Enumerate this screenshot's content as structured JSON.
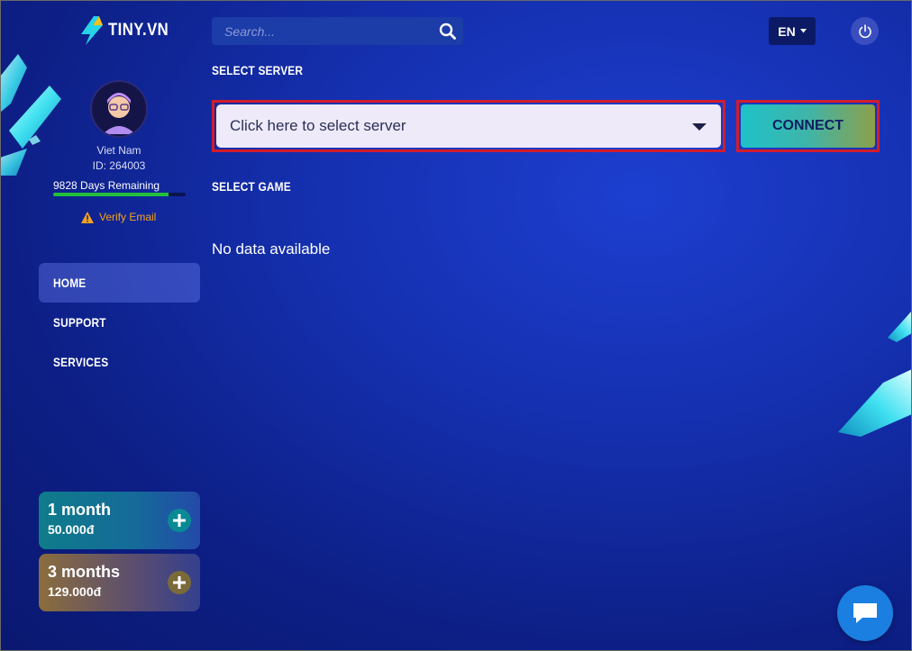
{
  "app": {
    "logo_text": "TINY.VN"
  },
  "user": {
    "country": "Viet Nam",
    "id": "ID: 264003",
    "days_remaining": "9828 Days Remaining",
    "days_progress": 0.87,
    "verify_email": "Verify Email"
  },
  "nav": {
    "items": [
      {
        "label": "HOME"
      },
      {
        "label": "SUPPORT"
      },
      {
        "label": "SERVICES"
      }
    ]
  },
  "plans": [
    {
      "name": "1 month",
      "price": "50.000đ"
    },
    {
      "name": "3 months",
      "price": "129.000đ"
    }
  ],
  "search": {
    "placeholder": "Search..."
  },
  "language": "EN",
  "select_server": {
    "title": "SELECT SERVER",
    "placeholder": "Click here to select server",
    "connect_label": "CONNECT"
  },
  "select_game": {
    "title": "SELECT GAME",
    "empty_text": "No data available"
  },
  "colors": {
    "accent": "#1ec1c8",
    "highlight_border": "#d11d2d",
    "warning": "#f6a21c",
    "progress": "#22c03a"
  }
}
